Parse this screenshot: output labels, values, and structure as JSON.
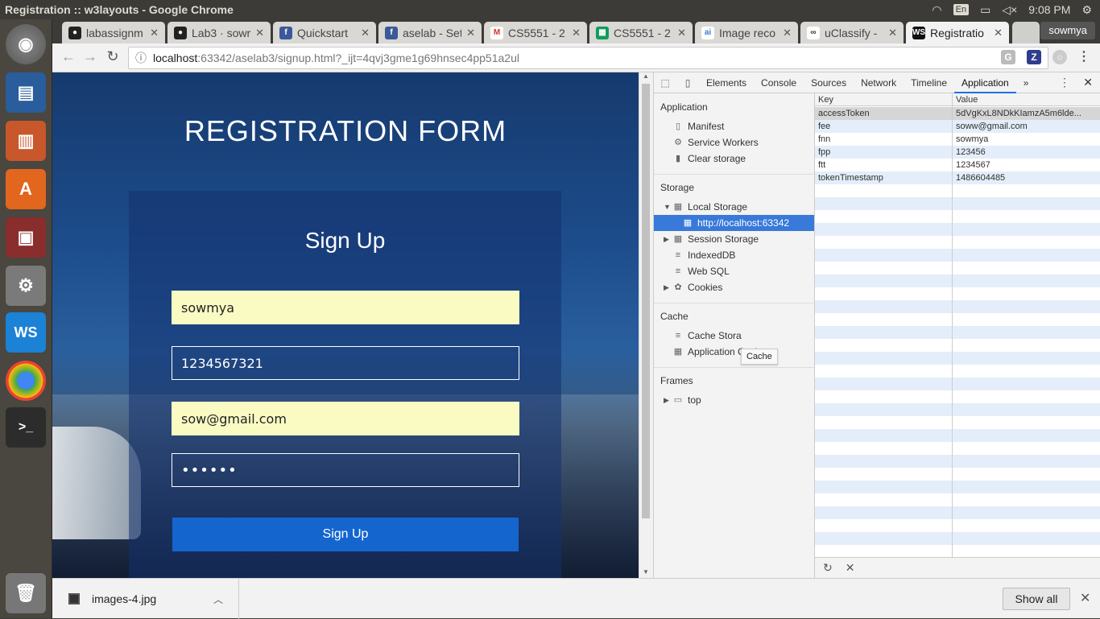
{
  "os": {
    "window_title": "Registration :: w3layouts - Google Chrome",
    "keyboard_layout": "En",
    "clock": "9:08 PM"
  },
  "browser": {
    "tabs": [
      {
        "label": "labassignm",
        "icon": "github-icon"
      },
      {
        "label": "Lab3 · sowr",
        "icon": "github-icon"
      },
      {
        "label": "Quickstart",
        "icon": "facebook-icon"
      },
      {
        "label": "aselab - Set",
        "icon": "facebook-icon"
      },
      {
        "label": "CS5551 - 2",
        "icon": "gmail-icon"
      },
      {
        "label": "CS5551 - 2",
        "icon": "sheets-icon"
      },
      {
        "label": "Image reco",
        "icon": "ai-icon"
      },
      {
        "label": "uClassify -",
        "icon": "uclassify-icon"
      },
      {
        "label": "Registratio",
        "icon": "webstorm-icon"
      }
    ],
    "profile": "sowmya",
    "url_host": "localhost",
    "url_path": ":63342/aselab3/signup.html?_ijt=4qvj3gme1g69hnsec4pp51a2ul"
  },
  "page": {
    "title": "REGISTRATION FORM",
    "form_title": "Sign Up",
    "name_value": "sowmya",
    "phone_value": "1234567321",
    "email_value": "sow@gmail.com",
    "password_value": "••••••",
    "submit_label": "Sign Up"
  },
  "devtools": {
    "tabs": [
      "Elements",
      "Console",
      "Sources",
      "Network",
      "Timeline",
      "Application"
    ],
    "more": "»",
    "sections": {
      "application": "Application",
      "storage": "Storage",
      "cache": "Cache",
      "frames": "Frames"
    },
    "app_items": [
      "Manifest",
      "Service Workers",
      "Clear storage"
    ],
    "storage_items": {
      "local_storage": "Local Storage",
      "local_origin": "http://localhost:63342",
      "session_storage": "Session Storage",
      "indexeddb": "IndexedDB",
      "websql": "Web SQL",
      "cookies": "Cookies"
    },
    "cache_items": [
      "Cache Stora",
      "Application Cache"
    ],
    "tooltip": "Cache",
    "frames_items": [
      "top"
    ],
    "table": {
      "headers": [
        "Key",
        "Value"
      ],
      "rows": [
        {
          "key": "accessToken",
          "value": "5dVgKxL8NDkKIamzA5m6lde..."
        },
        {
          "key": "fee",
          "value": "soww@gmail.com"
        },
        {
          "key": "fnn",
          "value": "sowmya"
        },
        {
          "key": "fpp",
          "value": "123456"
        },
        {
          "key": "ftt",
          "value": "1234567"
        },
        {
          "key": "tokenTimestamp",
          "value": "1486604485"
        }
      ]
    }
  },
  "downloads": {
    "file": "images-4.jpg",
    "show_all": "Show all"
  }
}
